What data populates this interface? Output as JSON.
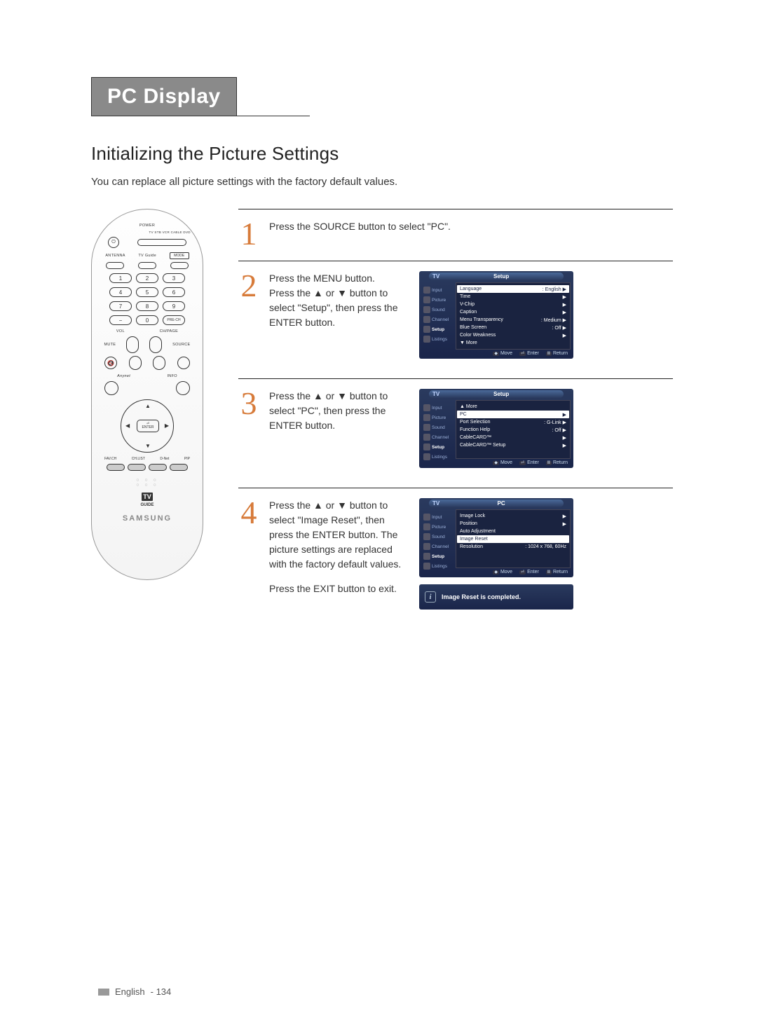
{
  "header": {
    "tab": "PC Display"
  },
  "section": {
    "title": "Initializing the Picture Settings",
    "intro": "You can replace all picture settings with the factory default values."
  },
  "remote": {
    "power": "POWER",
    "device_row": "TV  STB  VCR  CABLE  DVD",
    "antenna": "ANTENNA",
    "tvguide_lbl": "TV Guide",
    "mode": "MODE",
    "numbers": [
      "1",
      "2",
      "3",
      "4",
      "5",
      "6",
      "7",
      "8",
      "9",
      "−",
      "0",
      "PRE-CH"
    ],
    "vol": "VOL",
    "chpage": "CH/PAGE",
    "mute": "MUTE",
    "source": "SOURCE",
    "anynet": "Anynet",
    "info": "INFO",
    "enter": "ENTER",
    "bottom_labels": [
      "FAV.CH",
      "CH.LIST",
      "D-Net",
      "PIP"
    ],
    "tvguide_logo": "TV GUIDE",
    "brand": "SAMSUNG"
  },
  "steps": [
    {
      "num": "1",
      "text": "Press the SOURCE button to select \"PC\".",
      "osd": null
    },
    {
      "num": "2",
      "text": "Press the MENU button.\nPress the ▲ or ▼ button to select \"Setup\", then press the ENTER button.",
      "osd": {
        "tv": "TV",
        "title": "Setup",
        "sidebar": [
          "Input",
          "Picture",
          "Sound",
          "Channel",
          "Setup",
          "Listings"
        ],
        "active_side": "Setup",
        "rows": [
          {
            "label": "Language",
            "val": ": English",
            "arrow": true,
            "sel": true
          },
          {
            "label": "Time",
            "val": "",
            "arrow": true
          },
          {
            "label": "V-Chip",
            "val": "",
            "arrow": true
          },
          {
            "label": "Caption",
            "val": "",
            "arrow": true
          },
          {
            "label": "Menu Transparency",
            "val": ": Medium",
            "arrow": true
          },
          {
            "label": "Blue Screen",
            "val": ": Off",
            "arrow": true
          },
          {
            "label": "Color Weakness",
            "val": "",
            "arrow": true
          },
          {
            "label": "▼ More",
            "val": "",
            "arrow": false
          }
        ],
        "footer": [
          "Move",
          "Enter",
          "Return"
        ]
      }
    },
    {
      "num": "3",
      "text": "Press the ▲ or ▼ button to select \"PC\", then press the ENTER button.",
      "osd": {
        "tv": "TV",
        "title": "Setup",
        "sidebar": [
          "Input",
          "Picture",
          "Sound",
          "Channel",
          "Setup",
          "Listings"
        ],
        "active_side": "Setup",
        "rows": [
          {
            "label": "▲ More",
            "val": "",
            "arrow": false
          },
          {
            "label": "PC",
            "val": "",
            "arrow": true,
            "sel": true
          },
          {
            "label": "Port Selection",
            "val": ": G-Link",
            "arrow": true
          },
          {
            "label": "Function Help",
            "val": ": Off",
            "arrow": true
          },
          {
            "label": "CableCARD™",
            "val": "",
            "arrow": true
          },
          {
            "label": "CableCARD™ Setup",
            "val": "",
            "arrow": true
          }
        ],
        "footer": [
          "Move",
          "Enter",
          "Return"
        ]
      }
    },
    {
      "num": "4",
      "text": "Press the ▲ or ▼ button to select \"Image Reset\", then press the ENTER button. The picture settings are replaced with the factory default values.",
      "text2": "Press the EXIT button to exit.",
      "osd": {
        "tv": "TV",
        "title": "PC",
        "sidebar": [
          "Input",
          "Picture",
          "Sound",
          "Channel",
          "Setup",
          "Listings"
        ],
        "active_side": "Setup",
        "rows": [
          {
            "label": "Image Lock",
            "val": "",
            "arrow": true
          },
          {
            "label": "Position",
            "val": "",
            "arrow": true
          },
          {
            "label": "Auto Adjustment",
            "val": "",
            "arrow": false
          },
          {
            "label": "Image Reset",
            "val": "",
            "arrow": false,
            "sel": true
          },
          {
            "label": "Resolution",
            "val": ": 1024 x 768, 60Hz",
            "arrow": false
          }
        ],
        "footer": [
          "Move",
          "Enter",
          "Return"
        ]
      },
      "info_bar": "Image Reset is completed."
    }
  ],
  "footer": {
    "lang": "English",
    "page": "- 134"
  }
}
